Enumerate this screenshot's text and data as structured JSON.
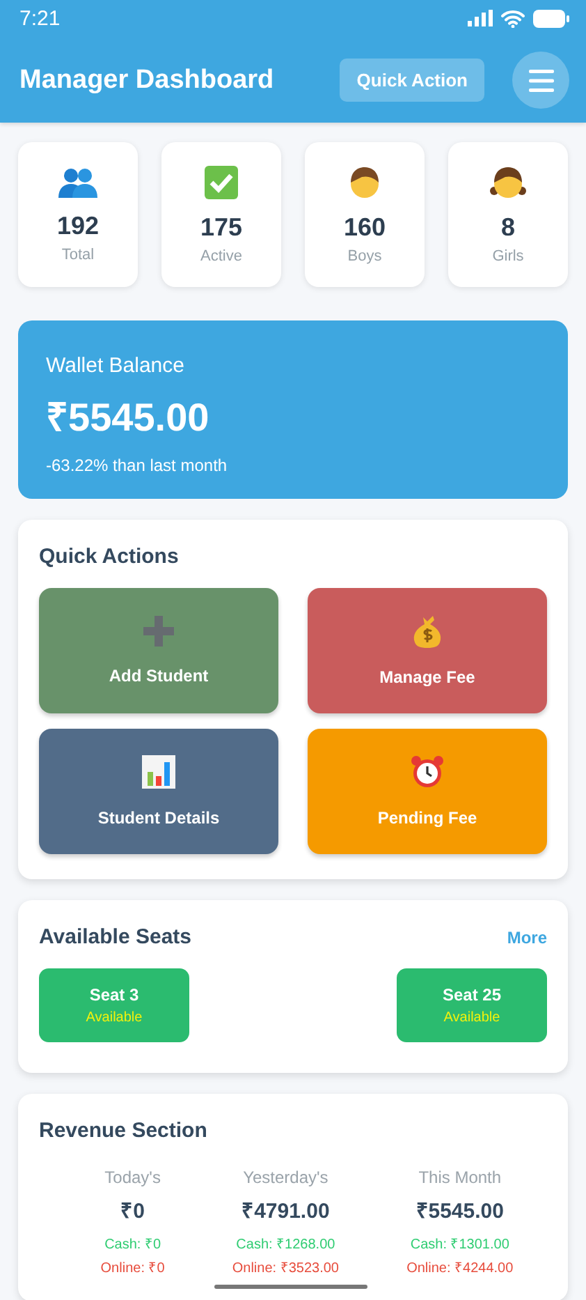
{
  "status_bar": {
    "time": "7:21"
  },
  "header": {
    "title": "Manager Dashboard",
    "action_button": "Quick Action"
  },
  "stats": [
    {
      "kind": "people",
      "value": "192",
      "label": "Total"
    },
    {
      "kind": "check",
      "value": "175",
      "label": "Active"
    },
    {
      "kind": "boy",
      "value": "160",
      "label": "Boys"
    },
    {
      "kind": "girl",
      "value": "8",
      "label": "Girls"
    }
  ],
  "wallet": {
    "title": "Wallet Balance",
    "amount": "₹5545.00",
    "change": "-63.22% than last month"
  },
  "quick_actions": {
    "title": "Quick Actions",
    "items": [
      {
        "kind": "plus",
        "label": "Add Student",
        "color": "#68926a"
      },
      {
        "kind": "moneybag",
        "label": "Manage Fee",
        "color": "#c95c5c"
      },
      {
        "kind": "chart",
        "label": "Student Details",
        "color": "#526c89"
      },
      {
        "kind": "alarm",
        "label": "Pending Fee",
        "color": "#f59a00"
      }
    ]
  },
  "seats": {
    "title": "Available Seats",
    "more": "More",
    "items": [
      {
        "name": "Seat 3",
        "status": "Available"
      },
      {
        "name": "Seat 25",
        "status": "Available"
      }
    ]
  },
  "revenue": {
    "title": "Revenue Section",
    "columns": [
      {
        "label": "Today's",
        "amount": "₹0",
        "cash": "Cash: ₹0",
        "online": "Online: ₹0"
      },
      {
        "label": "Yesterday's",
        "amount": "₹4791.00",
        "cash": "Cash: ₹1268.00",
        "online": "Online: ₹3523.00"
      },
      {
        "label": "This Month",
        "amount": "₹5545.00",
        "cash": "Cash: ₹1301.00",
        "online": "Online: ₹4244.00"
      }
    ]
  }
}
